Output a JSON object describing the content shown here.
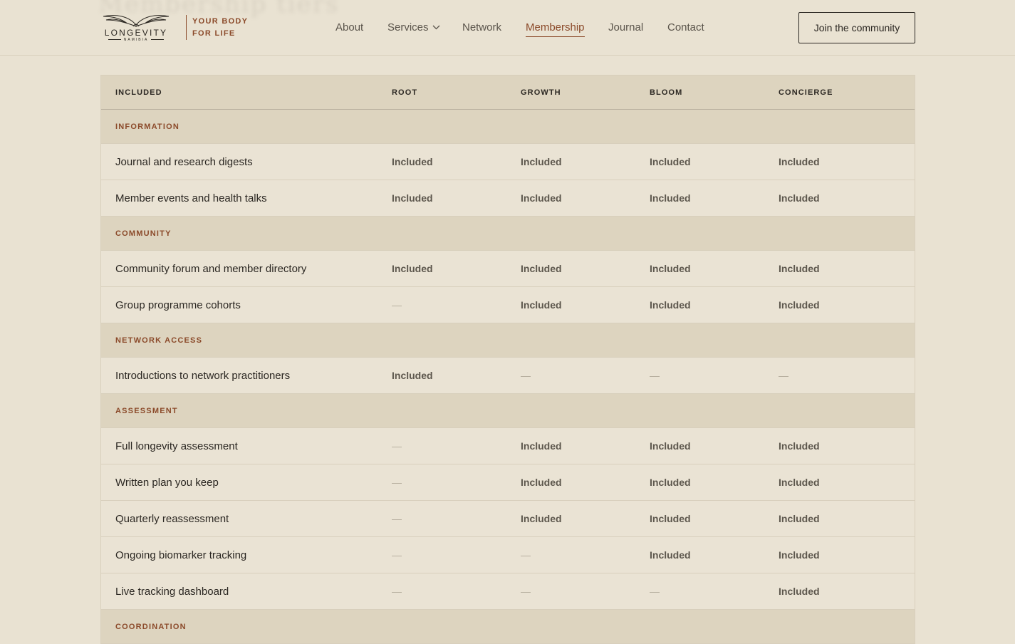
{
  "header": {
    "ghost_text": "Membership tiers",
    "logo": {
      "word": "LONGEVITY",
      "sub": "NAMIBIA"
    },
    "tagline": [
      "YOUR BODY",
      "FOR LIFE"
    ],
    "nav": [
      {
        "label": "About"
      },
      {
        "label": "Services"
      },
      {
        "label": "Network"
      },
      {
        "label": "Membership"
      },
      {
        "label": "Journal"
      },
      {
        "label": "Contact"
      }
    ],
    "cta_label": "Join the community"
  },
  "table": {
    "columns": [
      "INCLUDED",
      "ROOT",
      "GROWTH",
      "BLOOM",
      "CONCIERGE"
    ],
    "sections": [
      {
        "title": "INFORMATION",
        "rows": [
          {
            "feature": "Journal and research digests",
            "values": [
              "Included",
              "Included",
              "Included",
              "Included"
            ]
          },
          {
            "feature": "Member events and health talks",
            "values": [
              "Included",
              "Included",
              "Included",
              "Included"
            ]
          }
        ]
      },
      {
        "title": "COMMUNITY",
        "rows": [
          {
            "feature": "Community forum and member directory",
            "values": [
              "Included",
              "Included",
              "Included",
              "Included"
            ]
          },
          {
            "feature": "Group programme cohorts",
            "values": [
              "—",
              "Included",
              "Included",
              "Included"
            ]
          }
        ]
      },
      {
        "title": "NETWORK ACCESS",
        "rows": [
          {
            "feature": "Introductions to network practitioners",
            "values": [
              "Included",
              "—",
              "—",
              "—"
            ]
          }
        ]
      },
      {
        "title": "ASSESSMENT",
        "rows": [
          {
            "feature": "Full longevity assessment",
            "values": [
              "—",
              "Included",
              "Included",
              "Included"
            ]
          },
          {
            "feature": "Written plan you keep",
            "values": [
              "—",
              "Included",
              "Included",
              "Included"
            ]
          },
          {
            "feature": "Quarterly reassessment",
            "values": [
              "—",
              "Included",
              "Included",
              "Included"
            ]
          },
          {
            "feature": "Ongoing biomarker tracking",
            "values": [
              "—",
              "—",
              "Included",
              "Included"
            ]
          },
          {
            "feature": "Live tracking dashboard",
            "values": [
              "—",
              "—",
              "—",
              "Included"
            ]
          }
        ]
      },
      {
        "title": "COORDINATION",
        "rows": []
      }
    ]
  }
}
